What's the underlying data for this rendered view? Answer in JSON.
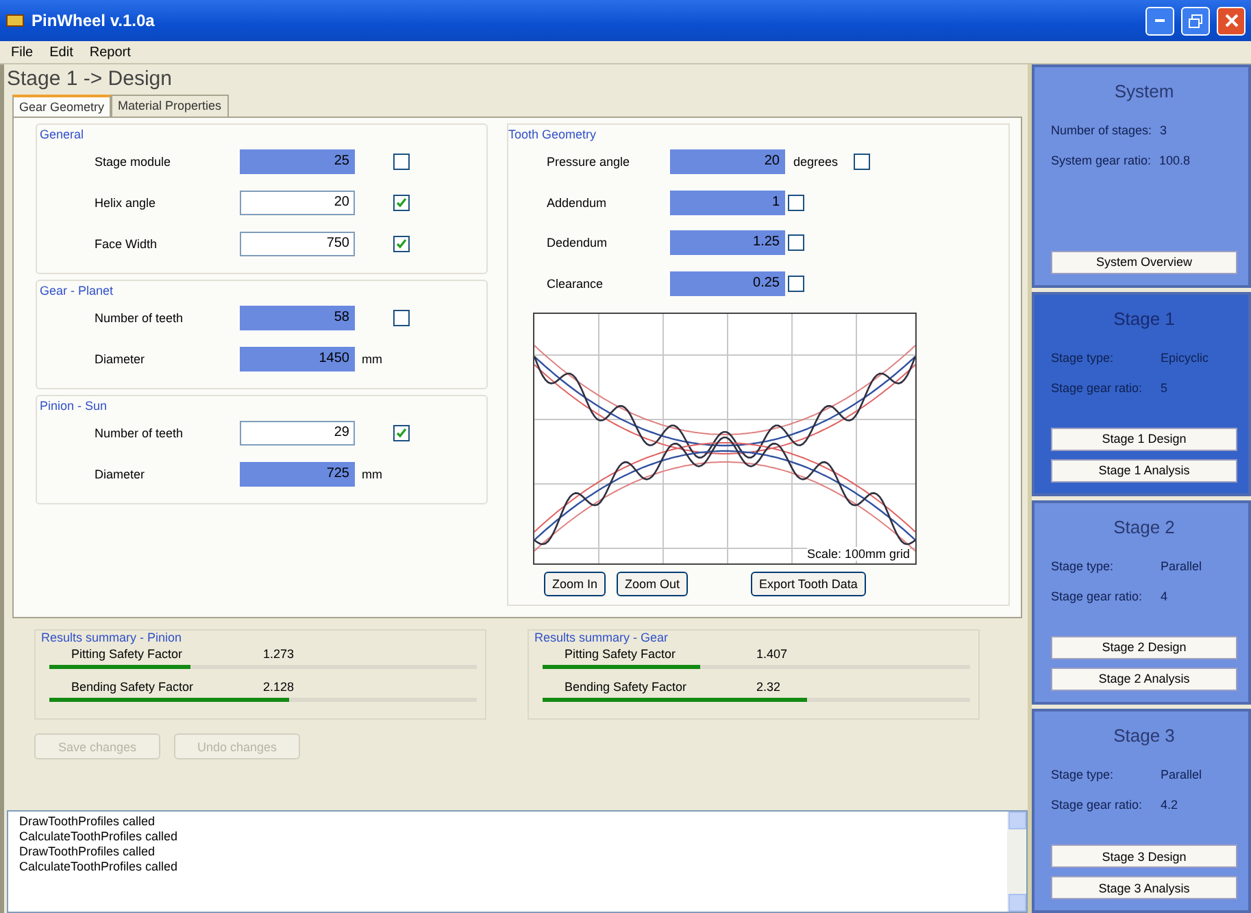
{
  "window": {
    "title": "PinWheel v.1.0a"
  },
  "menu": [
    "File",
    "Edit",
    "Report"
  ],
  "heading": "Stage 1 -> Design",
  "tabs": [
    {
      "label": "Gear Geometry",
      "selected": true
    },
    {
      "label": "Material Properties",
      "selected": false
    }
  ],
  "groups": [
    {
      "title": "General",
      "rows": [
        {
          "label": "Stage module",
          "value": "25",
          "highlighted": true,
          "checked": false
        },
        {
          "label": "Helix angle",
          "value": "20",
          "highlighted": false,
          "checked": true
        },
        {
          "label": "Face Width",
          "value": "750",
          "highlighted": false,
          "checked": true
        }
      ]
    },
    {
      "title": "Gear - Planet",
      "rows": [
        {
          "label": "Number of teeth",
          "value": "58",
          "highlighted": true,
          "checked": false
        },
        {
          "label": "Diameter",
          "value": "1450",
          "highlighted": true,
          "unit": "mm"
        }
      ]
    },
    {
      "title": "Pinion - Sun",
      "rows": [
        {
          "label": "Number of teeth",
          "value": "29",
          "highlighted": false,
          "checked": true
        },
        {
          "label": "Diameter",
          "value": "725",
          "highlighted": true,
          "unit": "mm"
        }
      ]
    }
  ],
  "tooth_geometry": {
    "title": "Tooth Geometry",
    "rows": [
      {
        "label": "Pressure angle",
        "value": "20",
        "highlighted": true,
        "unit": "degrees",
        "checked": false
      },
      {
        "label": "Addendum",
        "value": "1",
        "highlighted": true,
        "checked": false
      },
      {
        "label": "Dedendum",
        "value": "1.25",
        "highlighted": true,
        "checked": false
      },
      {
        "label": "Clearance",
        "value": "0.25",
        "highlighted": true,
        "checked": false
      }
    ],
    "scale_label": "Scale: 100mm grid",
    "buttons": [
      "Zoom In",
      "Zoom Out",
      "Export Tooth Data"
    ]
  },
  "results": [
    {
      "title": "Results summary - Pinion",
      "items": [
        {
          "label": "Pitting Safety Factor",
          "value": "1.273",
          "level": 0.33
        },
        {
          "label": "Bending Safety Factor",
          "value": "2.128",
          "level": 0.56
        }
      ]
    },
    {
      "title": "Results summary - Gear",
      "items": [
        {
          "label": "Pitting Safety Factor",
          "value": "1.407",
          "level": 0.37
        },
        {
          "label": "Bending Safety Factor",
          "value": "2.32",
          "level": 0.62
        }
      ]
    }
  ],
  "actions": [
    {
      "label": "Save changes",
      "disabled": true
    },
    {
      "label": "Undo changes",
      "disabled": true
    }
  ],
  "log": [
    "DrawToothProfiles called",
    "CalculateToothProfiles called",
    "DrawToothProfiles called",
    "CalculateToothProfiles called"
  ],
  "sidebar": [
    {
      "title": "System",
      "selected": false,
      "fields": [
        {
          "label": "Number of stages:",
          "value": "3"
        },
        {
          "label": "System gear ratio:",
          "value": "100.8"
        }
      ],
      "buttons": [
        "System Overview"
      ]
    },
    {
      "title": "Stage 1",
      "selected": true,
      "fields": [
        {
          "label": "Stage type:",
          "value": "Epicyclic"
        },
        {
          "label": "Stage gear ratio:",
          "value": "5"
        }
      ],
      "buttons": [
        "Stage 1 Design",
        "Stage 1 Analysis"
      ]
    },
    {
      "title": "Stage 2",
      "selected": false,
      "fields": [
        {
          "label": "Stage type:",
          "value": "Parallel"
        },
        {
          "label": "Stage gear ratio:",
          "value": "4"
        }
      ],
      "buttons": [
        "Stage 2 Design",
        "Stage 2 Analysis"
      ]
    },
    {
      "title": "Stage 3",
      "selected": false,
      "fields": [
        {
          "label": "Stage type:",
          "value": "Parallel"
        },
        {
          "label": "Stage gear ratio:",
          "value": "4.2"
        }
      ],
      "buttons": [
        "Stage 3 Design",
        "Stage 3 Analysis"
      ]
    }
  ]
}
